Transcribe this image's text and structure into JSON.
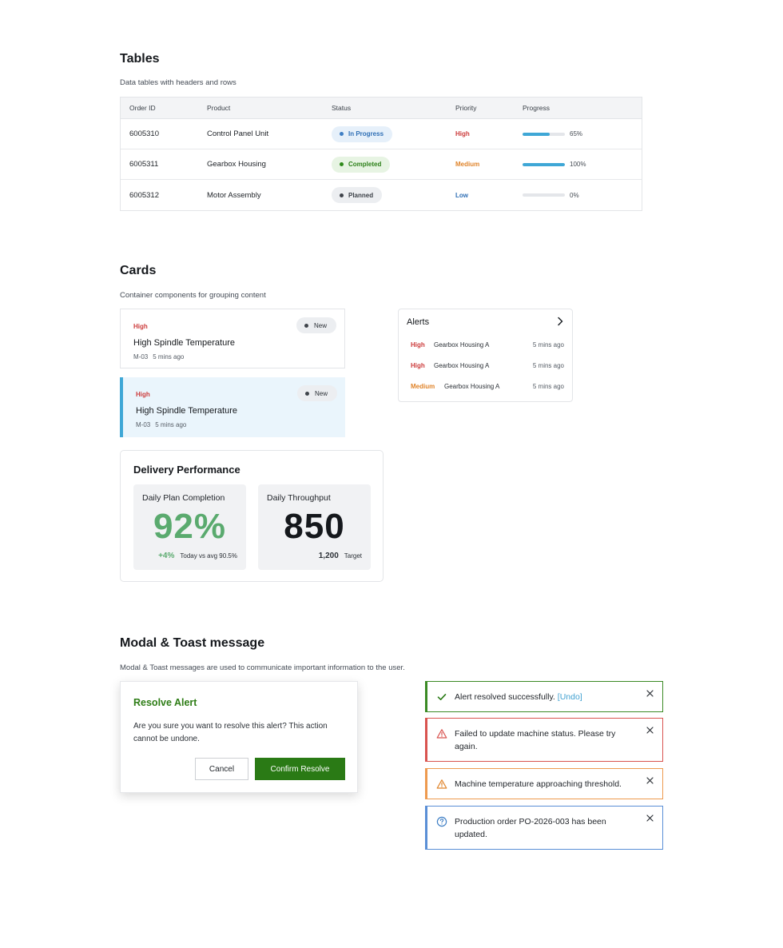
{
  "tables": {
    "title": "Tables",
    "subtitle": "Data tables with headers and rows",
    "headers": [
      "Order ID",
      "Product",
      "Status",
      "Priority",
      "Progress"
    ],
    "rows": [
      {
        "id": "6005310",
        "product": "Control Panel Unit",
        "status": "In Progress",
        "status_kind": "inprog",
        "priority": "High",
        "priority_kind": "high",
        "progress": 65,
        "progress_label": "65%"
      },
      {
        "id": "6005311",
        "product": "Gearbox Housing",
        "status": "Completed",
        "status_kind": "done",
        "priority": "Medium",
        "priority_kind": "medium",
        "progress": 100,
        "progress_label": "100%"
      },
      {
        "id": "6005312",
        "product": "Motor Assembly",
        "status": "Planned",
        "status_kind": "plan",
        "priority": "Low",
        "priority_kind": "low",
        "progress": 0,
        "progress_label": "0%"
      }
    ]
  },
  "cards": {
    "title": "Cards",
    "subtitle": "Container components for grouping content",
    "alert_cards": [
      {
        "severity": "High",
        "badge": "New",
        "title": "High Spindle Temperature",
        "machine": "M-03",
        "time": "5 mins ago",
        "selected": false
      },
      {
        "severity": "High",
        "badge": "New",
        "title": "High Spindle Temperature",
        "machine": "M-03",
        "time": "5 mins ago",
        "selected": true
      }
    ],
    "alerts_panel": {
      "title": "Alerts",
      "chevron_icon": "chevron-right-icon",
      "items": [
        {
          "priority": "High",
          "kind": "high",
          "name": "Gearbox Housing A",
          "time": "5 mins ago"
        },
        {
          "priority": "High",
          "kind": "high",
          "name": "Gearbox Housing A",
          "time": "5 mins ago"
        },
        {
          "priority": "Medium",
          "kind": "medium",
          "name": "Gearbox Housing A",
          "time": "5 mins ago"
        }
      ]
    },
    "delivery": {
      "title": "Delivery Performance",
      "plan_completion": {
        "label": "Daily Plan Completion",
        "value": "92%",
        "delta": "+4%",
        "delta_note": "Today vs avg 90.5%"
      },
      "throughput": {
        "label": "Daily Throughput",
        "value": "850",
        "target_value": "1,200",
        "target_label": "Target"
      }
    }
  },
  "modal_toast": {
    "title": "Modal & Toast  message",
    "subtitle": "Modal & Toast messages are used to communicate important information to the user.",
    "modal": {
      "title": "Resolve Alert",
      "body": "Are you sure you want to resolve this alert? This action cannot be undone.",
      "cancel_label": "Cancel",
      "confirm_label": "Confirm Resolve"
    },
    "toasts": [
      {
        "kind": "success",
        "icon": "check-icon",
        "message": "Alert resolved successfully.",
        "action": "[Undo]"
      },
      {
        "kind": "error",
        "icon": "warning-triangle-icon",
        "message": "Failed to update machine status. Please try again."
      },
      {
        "kind": "warning",
        "icon": "warning-triangle-icon",
        "message": "Machine temperature approaching threshold."
      },
      {
        "kind": "info",
        "icon": "question-circle-icon",
        "message": "Production order PO-2026-003 has been updated."
      }
    ]
  },
  "colors": {
    "accent_blue": "#3fa7d6",
    "success_green": "#2a7a15",
    "error_red": "#cc3b3b",
    "warning_orange": "#e0842a",
    "info_blue": "#3f7fc5"
  }
}
